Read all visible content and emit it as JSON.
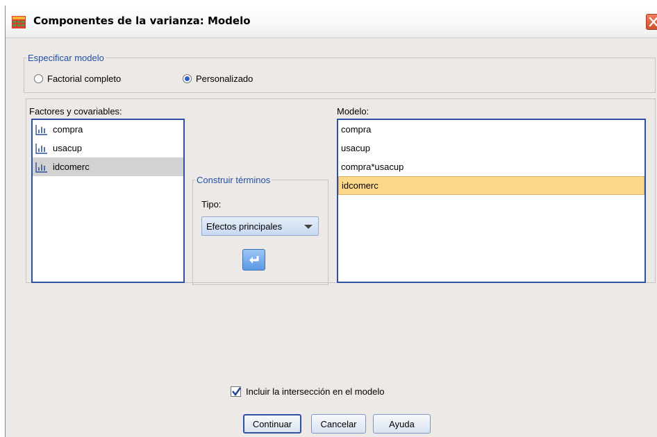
{
  "window": {
    "title": "Componentes de la varianza: Modelo",
    "accent_color": "#2d50a6"
  },
  "specify_model": {
    "legend": "Especificar modelo",
    "options": [
      {
        "label": "Factorial completo",
        "checked": false
      },
      {
        "label": "Personalizado",
        "checked": true
      }
    ]
  },
  "factors": {
    "label": "Factores y covariables:",
    "items": [
      "compra",
      "usacup",
      "idcomerc"
    ],
    "selected_index": 2
  },
  "build_terms": {
    "legend": "Construir términos",
    "type_label": "Tipo:",
    "type_value": "Efectos principales"
  },
  "model": {
    "label": "Modelo:",
    "items": [
      "compra",
      "usacup",
      "compra*usacup",
      "idcomerc"
    ],
    "selected_index": 3
  },
  "include_intercept": {
    "label": "Incluir la intersección en el modelo",
    "checked": true
  },
  "buttons": {
    "continue": "Continuar",
    "cancel": "Cancelar",
    "help": "Ayuda"
  }
}
